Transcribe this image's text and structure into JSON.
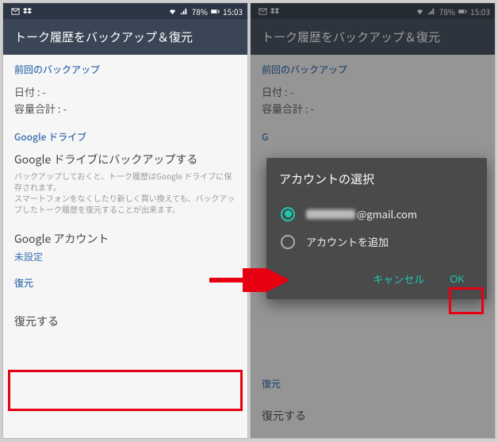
{
  "status": {
    "battery": "78%",
    "time": "15:03"
  },
  "header": {
    "title": "トーク履歴をバックアップ＆復元"
  },
  "sections": {
    "last_backup": {
      "title": "前回のバックアップ",
      "date_label": "日付 : -",
      "size_label": "容量合計 : -"
    },
    "gdrive": {
      "title": "Google ドライブ",
      "backup_title": "Google ドライブにバックアップする",
      "backup_desc1": "バックアップしておくと、トーク履歴はGoogle ドライブに保存されます。",
      "backup_desc2": "スマートフォンをなくしたり新しく買い換えても、バックアップしたトーク履歴を復元することが出来ます。",
      "account_title": "Google アカウント",
      "account_value": "未設定"
    },
    "restore": {
      "title": "復元",
      "action": "復元する"
    }
  },
  "dialog": {
    "title": "アカウントの選択",
    "account_suffix": "@gmail.com",
    "add_account": "アカウントを追加",
    "cancel": "キャンセル",
    "ok": "OK"
  }
}
